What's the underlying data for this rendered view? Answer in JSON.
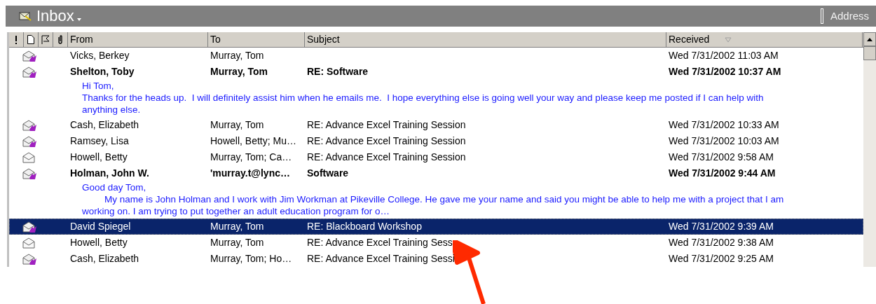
{
  "header": {
    "title": "Inbox",
    "address_label": "Address"
  },
  "columns": [
    {
      "label": "From"
    },
    {
      "label": "To"
    },
    {
      "label": "Subject"
    },
    {
      "label": "Received"
    }
  ],
  "rows": [
    {
      "kind": "replied",
      "unread": false,
      "selected": false,
      "from": "Vicks, Berkey",
      "to": "Murray, Tom",
      "subject": "",
      "received": "Wed 7/31/2002 11:03 AM",
      "preview": []
    },
    {
      "kind": "replied",
      "unread": true,
      "selected": false,
      "from": "Shelton, Toby",
      "to": "Murray, Tom",
      "subject": "RE: Software",
      "received": "Wed 7/31/2002 10:37 AM",
      "preview": [
        {
          "text": "Hi Tom,",
          "indent": false
        },
        {
          "text": "Thanks for the heads up.  I will definitely assist him when he emails me.  I hope everything else is going well your way and please keep me posted if I can help with",
          "indent": false
        },
        {
          "text": "anything else.",
          "indent": false
        }
      ]
    },
    {
      "kind": "replied",
      "unread": false,
      "selected": false,
      "from": "Cash, Elizabeth",
      "to": "Murray, Tom",
      "subject": "RE: Advance Excel Training Session",
      "received": "Wed 7/31/2002 10:33 AM",
      "preview": []
    },
    {
      "kind": "replied",
      "unread": false,
      "selected": false,
      "from": "Ramsey, Lisa",
      "to": "Howell, Betty; Mu…",
      "subject": "RE: Advance Excel Training Session",
      "received": "Wed 7/31/2002 10:03 AM",
      "preview": []
    },
    {
      "kind": "read",
      "unread": false,
      "selected": false,
      "from": "Howell, Betty",
      "to": "Murray, Tom; Ca…",
      "subject": "RE: Advance Excel Training Session",
      "received": "Wed 7/31/2002 9:58 AM",
      "preview": []
    },
    {
      "kind": "replied",
      "unread": true,
      "selected": false,
      "from": "Holman, John W.",
      "to": "'murray.t@lync…",
      "subject": "Software",
      "received": "Wed 7/31/2002 9:44 AM",
      "preview": [
        {
          "text": "Good day Tom,",
          "indent": false
        },
        {
          "text": "My name is John Holman and I work with Jim Workman at Pikeville College. He gave me your name and said you might be able to help me with a project that I am",
          "indent": true
        },
        {
          "text": "working on. I am trying to put together an adult education program for o…",
          "indent": false
        }
      ]
    },
    {
      "kind": "replied",
      "unread": false,
      "selected": true,
      "from": "David Spiegel",
      "to": "Murray, Tom",
      "subject": "RE: Blackboard Workshop",
      "received": "Wed 7/31/2002 9:39 AM",
      "preview": []
    },
    {
      "kind": "read",
      "unread": false,
      "selected": false,
      "from": "Howell, Betty",
      "to": "Murray, Tom",
      "subject": "RE: Advance Excel Training Sess",
      "received": "Wed 7/31/2002 9:38 AM",
      "preview": []
    },
    {
      "kind": "replied",
      "unread": false,
      "selected": false,
      "from": "Cash, Elizabeth",
      "to": "Murray, Tom; Ho…",
      "subject": "RE: Advance Excel Training Sessi",
      "received": "Wed 7/31/2002 9:25 AM",
      "preview": []
    }
  ]
}
